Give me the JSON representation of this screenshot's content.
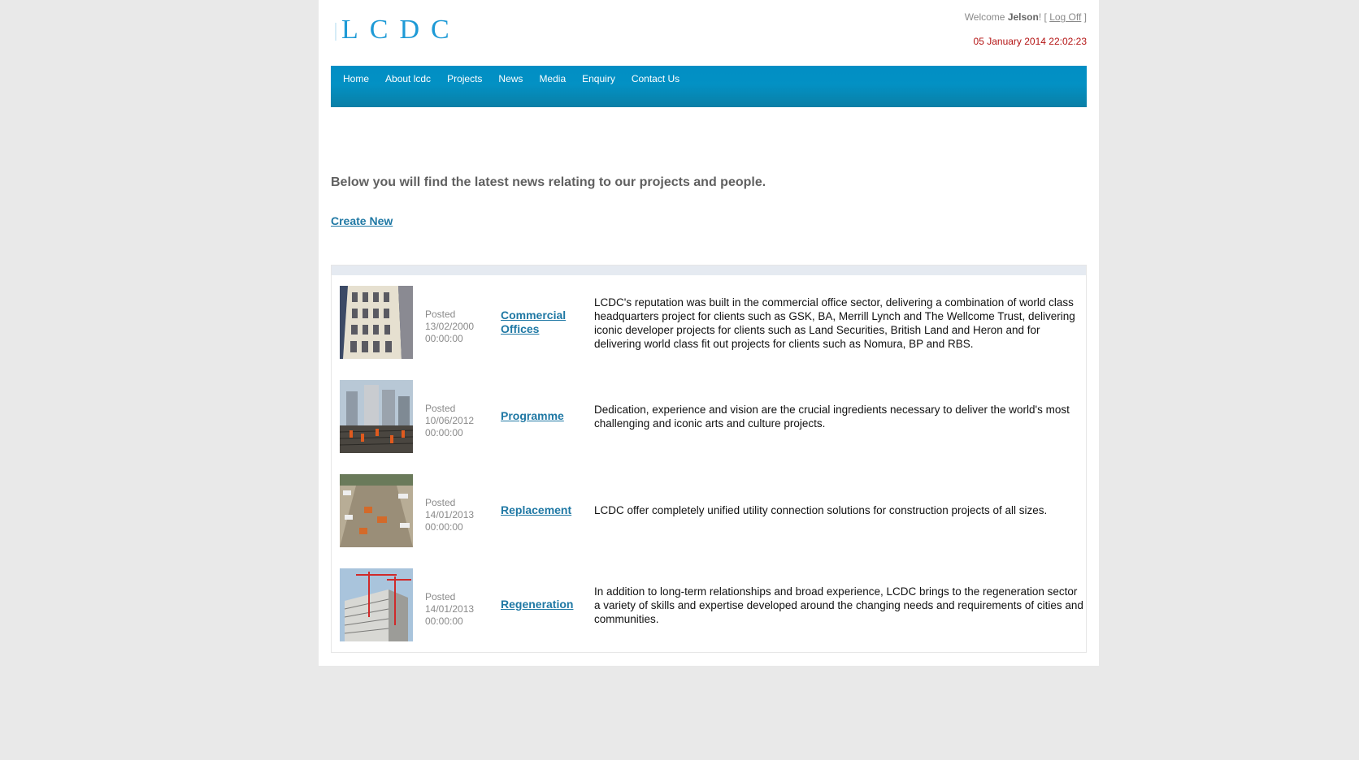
{
  "brand": {
    "logo_text": "LCDC"
  },
  "header": {
    "welcome_prefix": "Welcome ",
    "username": "Jelson",
    "welcome_suffix": "! [ ",
    "logout_label": "Log Off",
    "logout_suffix": " ]",
    "datetime": "05 January 2014 22:02:23"
  },
  "nav": {
    "items": [
      "Home",
      "About lcdc",
      "Projects",
      "News",
      "Media",
      "Enquiry",
      "Contact Us"
    ]
  },
  "main": {
    "intro": "Below you will find the latest news relating to our projects and people.",
    "create_label": "Create New"
  },
  "news": [
    {
      "posted_label": "Posted",
      "date": "13/02/2000",
      "time": "00:00:00",
      "title": "Commercial Offices",
      "description": "LCDC's reputation was built in the commercial office sector, delivering a combination of world class headquarters project for clients such as GSK, BA, Merrill Lynch and The Wellcome Trust, delivering iconic developer projects for clients such as Land Securities, British Land and Heron and for delivering world class fit out projects for clients such as Nomura, BP and RBS.",
      "image": "office-building-photo"
    },
    {
      "posted_label": "Posted",
      "date": "10/06/2012",
      "time": "00:00:00",
      "title": "Programme",
      "description": "Dedication, experience and vision are the crucial ingredients necessary to deliver the world's most challenging and iconic arts and culture projects.",
      "image": "construction-site-photo"
    },
    {
      "posted_label": "Posted",
      "date": "14/01/2013",
      "time": "00:00:00",
      "title": "Replacement",
      "description": "LCDC offer completely unified utility connection solutions for construction projects of all sizes.",
      "image": "street-works-photo"
    },
    {
      "posted_label": "Posted",
      "date": "14/01/2013",
      "time": "00:00:00",
      "title": "Regeneration",
      "description": "In addition to long-term relationships and broad experience, LCDC brings to the regeneration sector a variety of skills and expertise developed around the changing needs and requirements of cities and communities.",
      "image": "cranes-building-photo"
    }
  ],
  "colors": {
    "nav_blue": "#0391c4",
    "link_blue": "#1f78a4",
    "datetime_red": "#b41414",
    "logo_blue": "#1e9ad6"
  }
}
